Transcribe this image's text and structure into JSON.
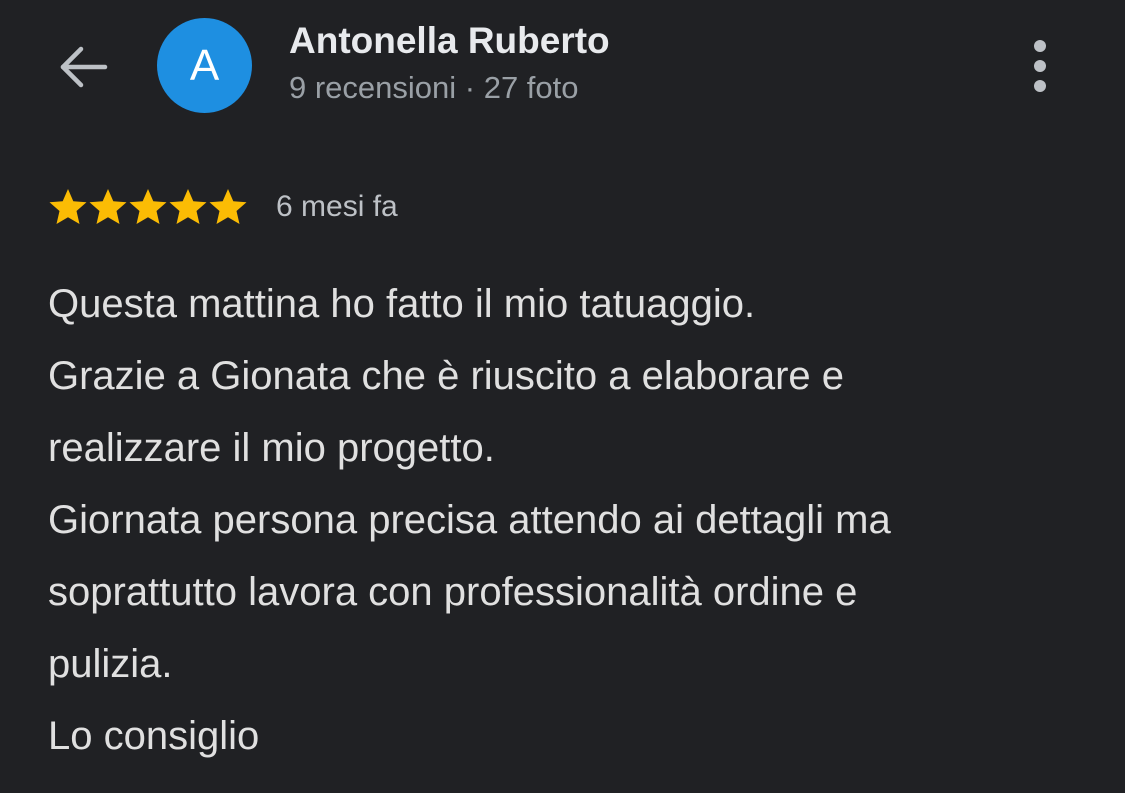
{
  "header": {
    "back_icon": "arrow-back-icon",
    "avatar_initial": "A",
    "avatar_color": "#1e8fe1",
    "author_name": "Antonella Ruberto",
    "author_meta": "9 recensioni · 27 foto",
    "more_icon": "more-vertical-icon"
  },
  "review": {
    "rating": 5,
    "rating_max": 5,
    "star_color": "#fbbc04",
    "date": "6 mesi fa",
    "lines": [
      "Questa mattina ho fatto il mio tatuaggio.",
      "Grazie a Gionata che è riuscito a elaborare e",
      "realizzare il mio progetto.",
      "Giornata persona precisa attendo ai dettagli ma",
      "soprattutto lavora con professionalità ordine e",
      "pulizia.",
      "Lo consiglio"
    ]
  }
}
